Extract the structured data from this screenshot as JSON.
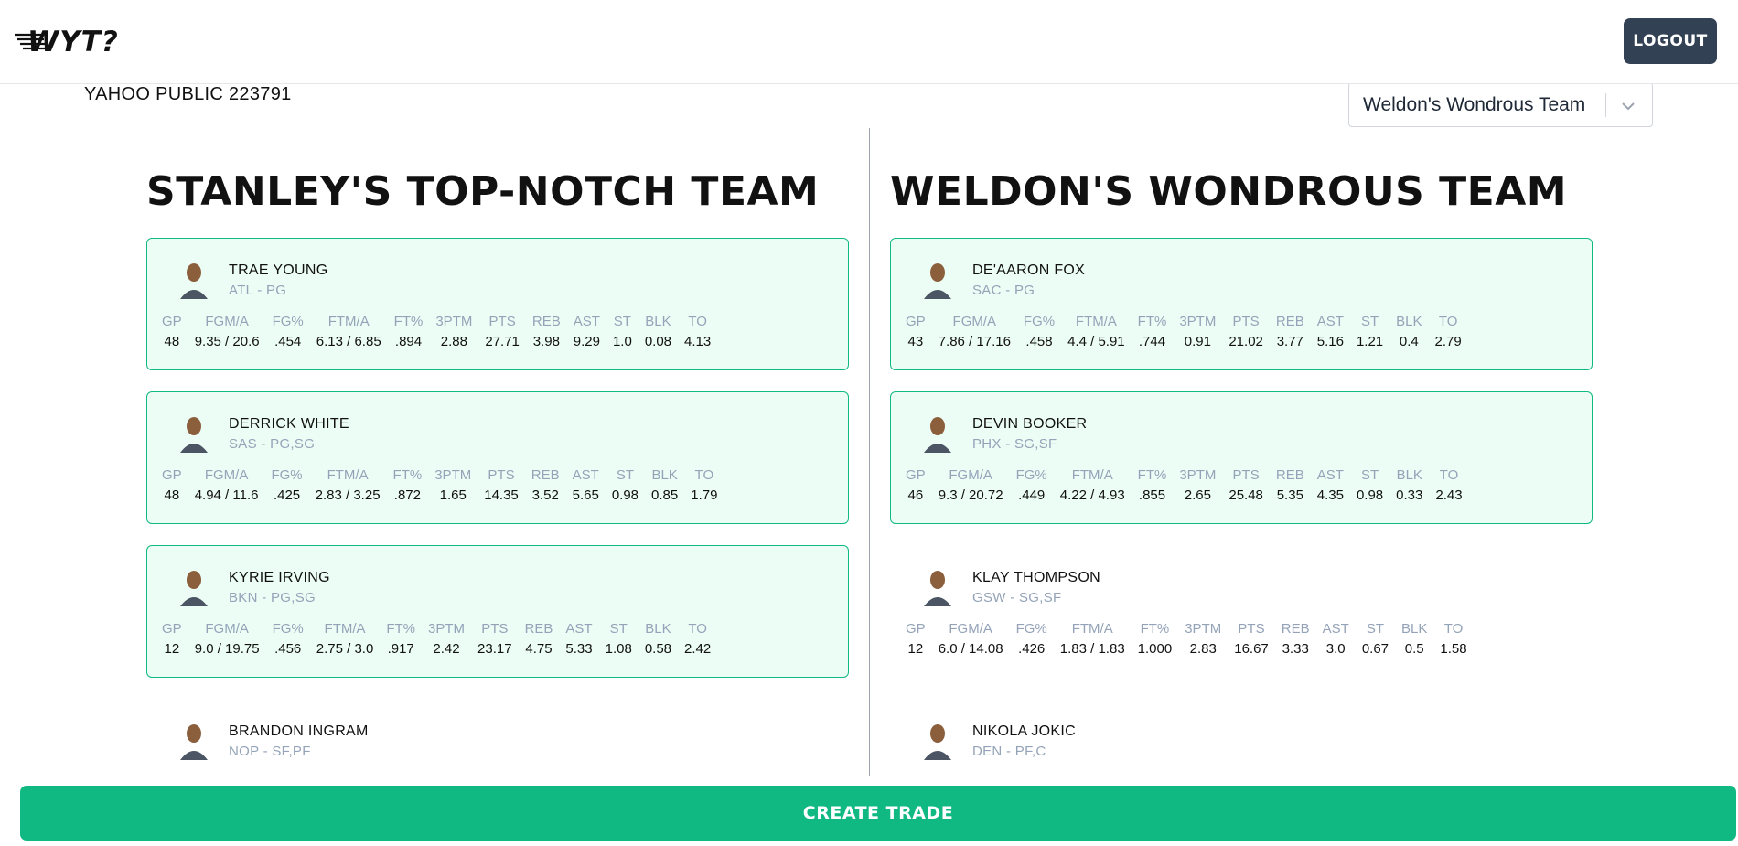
{
  "header": {
    "logo_text": "WYT?",
    "logout_label": "LOGOUT"
  },
  "league": {
    "label": "YAHOO PUBLIC 223791"
  },
  "team_selector": {
    "selected": "Weldon's Wondrous Team"
  },
  "stat_headers": [
    "GP",
    "FGM/A",
    "FG%",
    "FTM/A",
    "FT%",
    "3PTM",
    "PTS",
    "REB",
    "AST",
    "ST",
    "BLK",
    "TO"
  ],
  "left_team": {
    "title": "STANLEY'S TOP-NOTCH TEAM",
    "players": [
      {
        "name": "TRAE YOUNG",
        "meta": "ATL - PG",
        "selected": true,
        "stats": [
          "48",
          "9.35 / 20.6",
          ".454",
          "6.13 / 6.85",
          ".894",
          "2.88",
          "27.71",
          "3.98",
          "9.29",
          "1.0",
          "0.08",
          "4.13"
        ]
      },
      {
        "name": "DERRICK WHITE",
        "meta": "SAS - PG,SG",
        "selected": true,
        "stats": [
          "48",
          "4.94 / 11.6",
          ".425",
          "2.83 / 3.25",
          ".872",
          "1.65",
          "14.35",
          "3.52",
          "5.65",
          "0.98",
          "0.85",
          "1.79"
        ]
      },
      {
        "name": "KYRIE IRVING",
        "meta": "BKN - PG,SG",
        "selected": true,
        "stats": [
          "12",
          "9.0 / 19.75",
          ".456",
          "2.75 / 3.0",
          ".917",
          "2.42",
          "23.17",
          "4.75",
          "5.33",
          "1.08",
          "0.58",
          "2.42"
        ]
      },
      {
        "name": "BRANDON INGRAM",
        "meta": "NOP - SF,PF",
        "selected": false,
        "stats": [
          "",
          "",
          "",
          "",
          "",
          "",
          "",
          "",
          "",
          "",
          "",
          ""
        ]
      }
    ]
  },
  "right_team": {
    "title": "WELDON'S WONDROUS TEAM",
    "players": [
      {
        "name": "DE'AARON FOX",
        "meta": "SAC - PG",
        "selected": true,
        "stats": [
          "43",
          "7.86 / 17.16",
          ".458",
          "4.4 / 5.91",
          ".744",
          "0.91",
          "21.02",
          "3.77",
          "5.16",
          "1.21",
          "0.4",
          "2.79"
        ]
      },
      {
        "name": "DEVIN BOOKER",
        "meta": "PHX - SG,SF",
        "selected": true,
        "stats": [
          "46",
          "9.3 / 20.72",
          ".449",
          "4.22 / 4.93",
          ".855",
          "2.65",
          "25.48",
          "5.35",
          "4.35",
          "0.98",
          "0.33",
          "2.43"
        ]
      },
      {
        "name": "KLAY THOMPSON",
        "meta": "GSW - SG,SF",
        "selected": false,
        "stats": [
          "12",
          "6.0 / 14.08",
          ".426",
          "1.83 / 1.83",
          "1.000",
          "2.83",
          "16.67",
          "3.33",
          "3.0",
          "0.67",
          "0.5",
          "1.58"
        ]
      },
      {
        "name": "NIKOLA JOKIC",
        "meta": "DEN - PF,C",
        "selected": false,
        "stats": [
          "",
          "",
          "",
          "",
          "",
          "",
          "",
          "",
          "",
          "",
          "",
          ""
        ]
      }
    ]
  },
  "actions": {
    "create_trade_label": "CREATE TRADE"
  },
  "colors": {
    "accent": "#10b981",
    "card_bg": "#ecfdf5",
    "button_dark": "#334155",
    "muted_text": "#94a3b8"
  }
}
